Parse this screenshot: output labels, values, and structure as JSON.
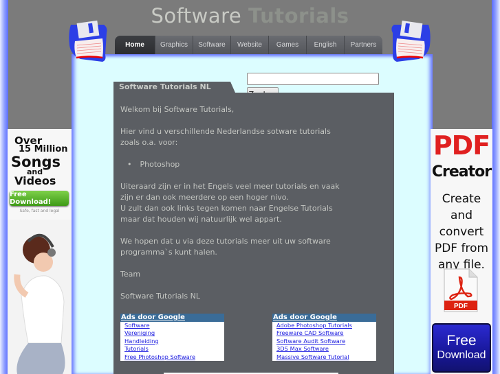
{
  "header": {
    "title_part1": "Software",
    "title_part2": "Tutorials"
  },
  "nav": {
    "items": [
      {
        "label": "Home",
        "active": true
      },
      {
        "label": "Graphics"
      },
      {
        "label": "Software"
      },
      {
        "label": "Website"
      },
      {
        "label": "Games"
      },
      {
        "label": "English"
      },
      {
        "label": "Partners"
      }
    ]
  },
  "search": {
    "value": "",
    "button_label": "Zoeken"
  },
  "content": {
    "tab_title": "Software Tutorials NL",
    "paragraphs": [
      "Welkom bij Software Tutorials,",
      "Hier vind u verschillende Nederlandse sotware tutorials zoals o.a. voor:",
      "Uiteraard zijn er in het Engels veel meer tutorials en vaak zijn er dan ook meerdere op een hoger nivo.",
      "U zult dan ook links tegen komen naar Engelse Tutorials maar dat houden wij natuurlijk wel appart.",
      "We hopen dat u via deze tutorials meer uit uw software programma`s kunt halen.",
      "Team",
      "Software Tutorials NL"
    ],
    "list_items": [
      "Photoshop"
    ]
  },
  "ads": {
    "left": {
      "header": "Ads door Google",
      "links": [
        "Software",
        "Vereniging",
        "Handleiding",
        "Tutorials",
        "Free Photoshop Software"
      ]
    },
    "right": {
      "header": "Ads door Google",
      "links": [
        "Adobe Photoshop Tutorials",
        "Freeware CAD Software",
        "Software Audit Software",
        "3DS Max Software",
        "Massive Software Tutorial"
      ]
    }
  },
  "side_ad_left": {
    "line1": "Over",
    "line2": "15 Million",
    "line3": "Songs",
    "line4": "and",
    "line5": "Videos",
    "button": "Free Download!",
    "tagline": "Safe, fast and legal"
  },
  "side_ad_right": {
    "brand_big": "PDF",
    "brand_sub": "Creator",
    "description": [
      "Create and",
      "convert",
      "PDF from",
      "any file."
    ],
    "icon_label": "PDF",
    "button_line1": "Free",
    "button_line2": "Download"
  },
  "colors": {
    "page_bg": "#7b7b7b",
    "panel_bg": "#dcfdff",
    "content_bg": "#5b5e63",
    "ads_header": "#3a6c98",
    "link": "#1a1adf",
    "border_blue": "#5b6dff"
  }
}
